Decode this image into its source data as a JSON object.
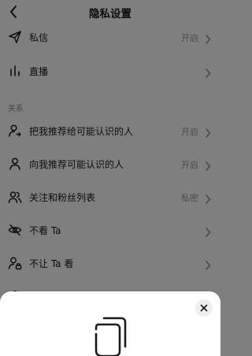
{
  "header": {
    "title": "隐私设置",
    "back_icon": "back-arrow-icon"
  },
  "rows_top": [
    {
      "id": "private-message",
      "icon": "paper-plane-icon",
      "label": "私信",
      "value": "开启"
    },
    {
      "id": "live",
      "icon": "bar-chart-icon",
      "label": "直播",
      "value": ""
    }
  ],
  "section": {
    "relations_label": "关系"
  },
  "rows_relations": [
    {
      "id": "recommend-me",
      "icon": "user-share-icon",
      "label": "把我推荐给可能认识的人",
      "value": "开启"
    },
    {
      "id": "recommend-to-me",
      "icon": "user-recommend-icon",
      "label": "向我推荐可能认识的人",
      "value": "开启"
    },
    {
      "id": "follow-fans-list",
      "icon": "users-icon",
      "label": "关注和粉丝列表",
      "value": "私密"
    },
    {
      "id": "not-see-ta",
      "icon": "eye-off-icon",
      "label": "不看 Ta",
      "value": ""
    },
    {
      "id": "not-let-ta-see",
      "icon": "user-lock-icon",
      "label": "不让 Ta 看",
      "value": ""
    }
  ],
  "sheet": {
    "close_icon": "close-icon",
    "doc_icon": "documents-icon"
  },
  "colors": {
    "overlay": "#000000",
    "sheet_bg": "#ffffff",
    "muted_text": "#9a9a9a"
  }
}
